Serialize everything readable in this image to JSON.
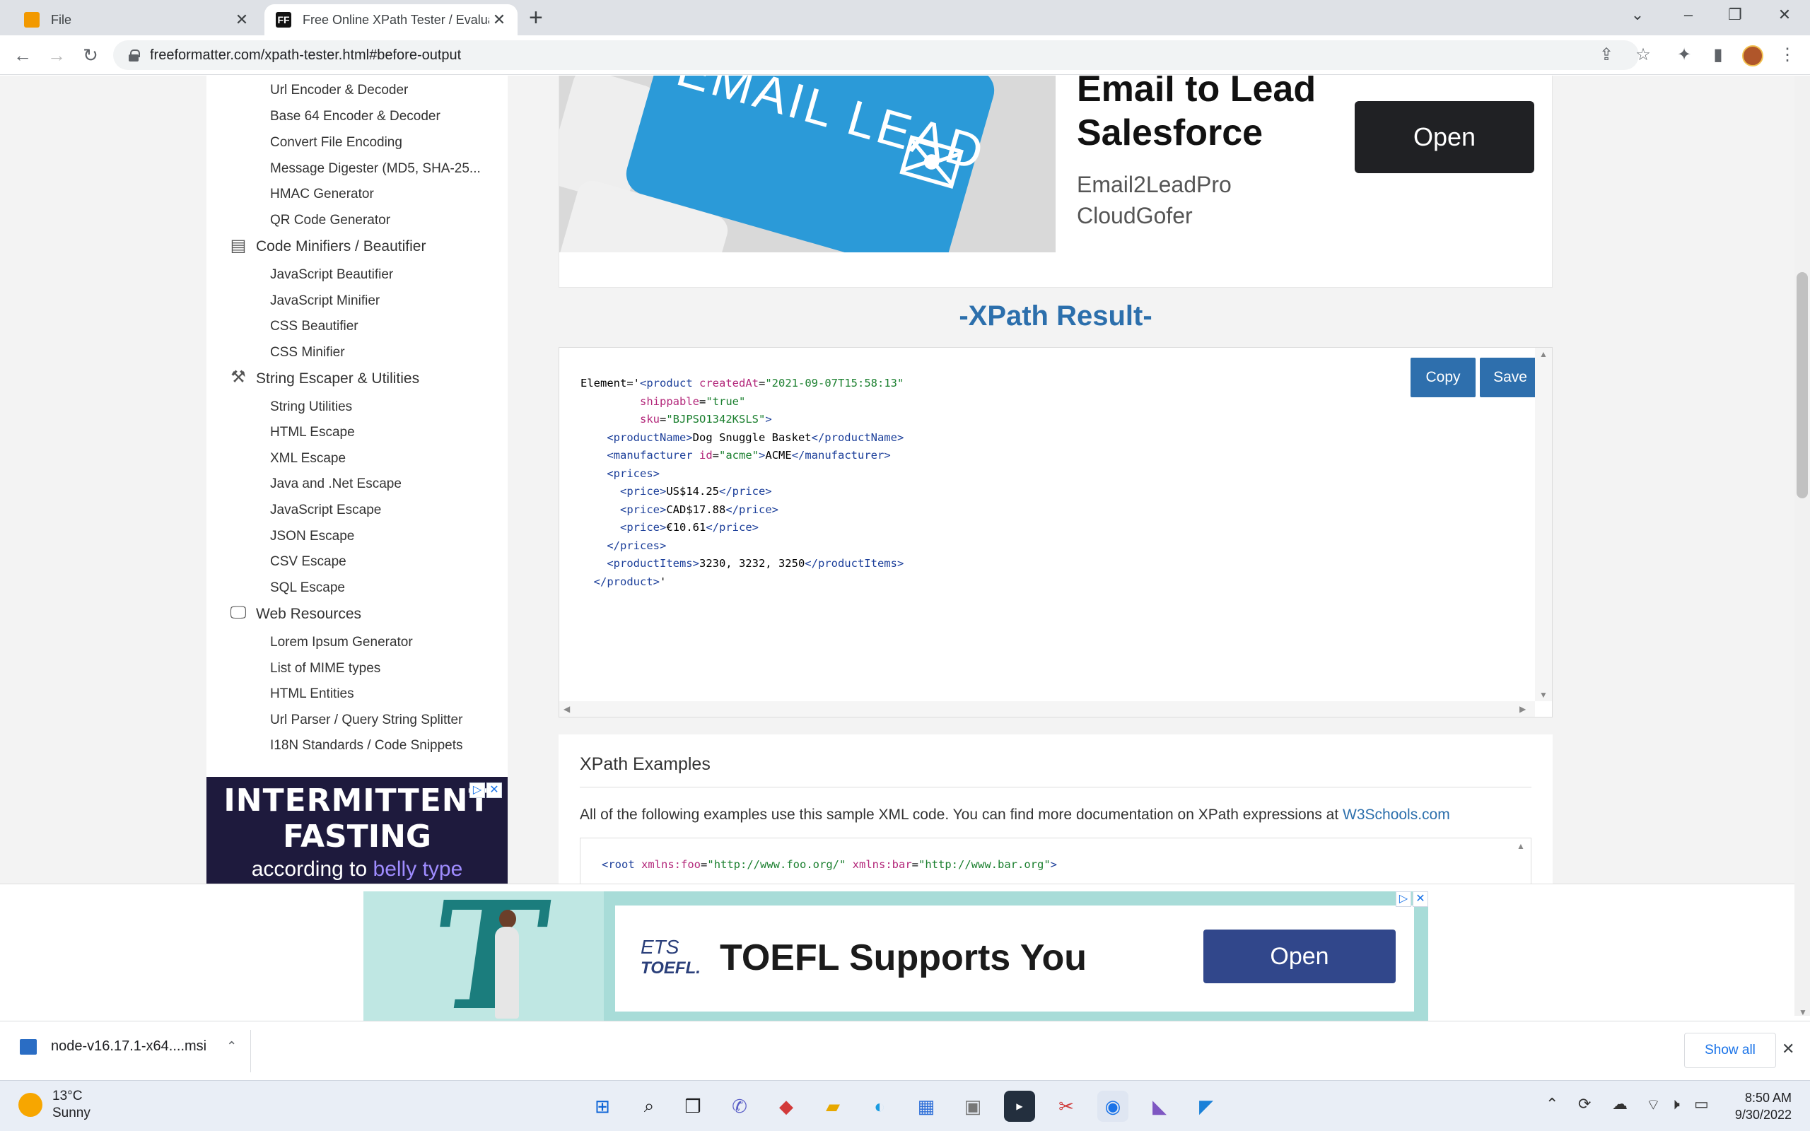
{
  "browser": {
    "tabs": [
      {
        "title": "File",
        "active": false
      },
      {
        "title": "Free Online XPath Tester / Evalua",
        "active": true
      }
    ],
    "url": "freeformatter.com/xpath-tester.html#before-output"
  },
  "sidebar": {
    "items_top": [
      "Url Encoder & Decoder",
      "Base 64 Encoder & Decoder",
      "Convert File Encoding",
      "Message Digester (MD5, SHA-25...",
      "HMAC Generator",
      "QR Code Generator"
    ],
    "section_minifiers": {
      "title": "Code Minifiers / Beautifier",
      "items": [
        "JavaScript Beautifier",
        "JavaScript Minifier",
        "CSS Beautifier",
        "CSS Minifier"
      ]
    },
    "section_escapers": {
      "title": "String Escaper & Utilities",
      "items": [
        "String Utilities",
        "HTML Escape",
        "XML Escape",
        "Java and .Net Escape",
        "JavaScript Escape",
        "JSON Escape",
        "CSV Escape",
        "SQL Escape"
      ]
    },
    "section_web": {
      "title": "Web Resources",
      "items": [
        "Lorem Ipsum Generator",
        "List of MIME types",
        "HTML Entities",
        "Url Parser / Query String Splitter",
        "I18N Standards / Code Snippets"
      ]
    },
    "ad": {
      "line1": "INTERMITTENT",
      "line2": "FASTING",
      "line3a": "according to ",
      "line3b": "belly type"
    }
  },
  "top_ad": {
    "headline_line1": "Email to Lead",
    "headline_line2": "Salesforce",
    "sub_line1": "Email2LeadPro",
    "sub_line2": "CloudGofer",
    "button": "Open",
    "image_text": "EMAIL LEAD"
  },
  "result": {
    "title": "-XPath Result-",
    "copy_label": "Copy",
    "save_label": "Save"
  },
  "examples": {
    "heading": "XPath Examples",
    "intro": "All of the following examples use this sample XML code. You can find more documentation on XPath expressions at ",
    "link": "W3Schools.com"
  },
  "bottom_ad": {
    "brand_top": "ETS",
    "brand_bottom": "TOEFL.",
    "slogan": "TOEFL Supports You",
    "button": "Open"
  },
  "download_bar": {
    "file": "node-v16.17.1-x64....msi",
    "show_all": "Show all"
  },
  "taskbar": {
    "temp": "13°C",
    "condition": "Sunny",
    "time": "8:50 AM",
    "date": "9/30/2022"
  }
}
